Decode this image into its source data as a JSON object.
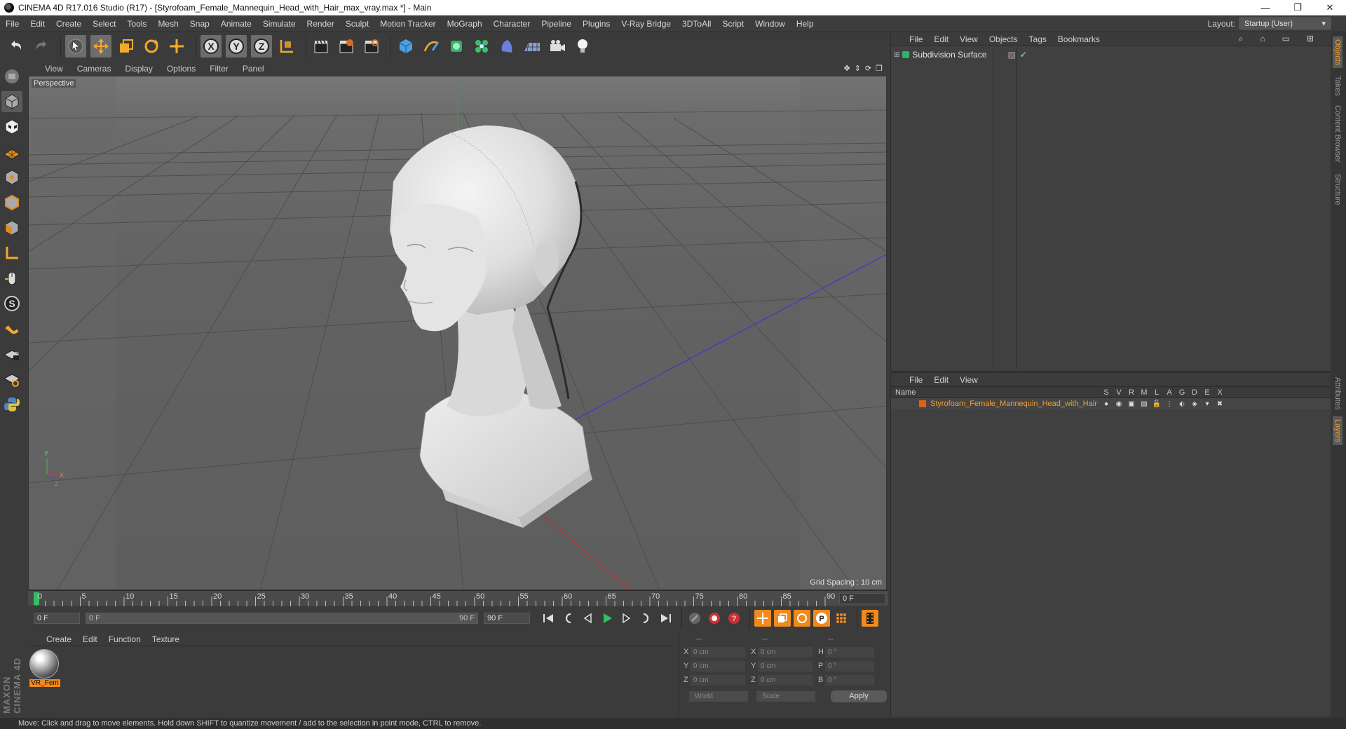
{
  "window": {
    "title": "CINEMA 4D R17.016 Studio (R17) - [Styrofoam_Female_Mannequin_Head_with_Hair_max_vray.max *] - Main",
    "controls": [
      "—",
      "❐",
      "✕"
    ]
  },
  "menubar": {
    "items": [
      "File",
      "Edit",
      "Create",
      "Select",
      "Tools",
      "Mesh",
      "Snap",
      "Animate",
      "Simulate",
      "Render",
      "Sculpt",
      "Motion Tracker",
      "MoGraph",
      "Character",
      "Pipeline",
      "Plugins",
      "V-Ray Bridge",
      "3DToAll",
      "Script",
      "Window",
      "Help"
    ],
    "layout_label": "Layout:",
    "layout_value": "Startup (User)"
  },
  "viewport": {
    "menus": [
      "View",
      "Cameras",
      "Display",
      "Options",
      "Filter",
      "Panel"
    ],
    "camera_label": "Perspective",
    "grid_spacing": "Grid Spacing : 10 cm",
    "axis_labels": [
      "Y",
      "X",
      "Z"
    ]
  },
  "timeline": {
    "ticks": [
      "0",
      "5",
      "10",
      "15",
      "20",
      "25",
      "30",
      "35",
      "40",
      "45",
      "50",
      "55",
      "60",
      "65",
      "70",
      "75",
      "80",
      "85",
      "90"
    ],
    "current_frame": "0 F",
    "start_field": "0 F",
    "range_start": "0 F",
    "range_end": "90 F",
    "end_field": "90 F"
  },
  "material_manager": {
    "menus": [
      "Create",
      "Edit",
      "Function",
      "Texture"
    ],
    "material_name": "VR_Fem"
  },
  "coordinates": {
    "top_labels": [
      "--",
      "--",
      "--"
    ],
    "rows": [
      {
        "axis": "X",
        "pos": "0 cm",
        "axis2": "X",
        "size": "0 cm",
        "axis3": "H",
        "rot": "0 °"
      },
      {
        "axis": "Y",
        "pos": "0 cm",
        "axis2": "Y",
        "size": "0 cm",
        "axis3": "P",
        "rot": "0 °"
      },
      {
        "axis": "Z",
        "pos": "0 cm",
        "axis2": "Z",
        "size": "0 cm",
        "axis3": "B",
        "rot": "0 °"
      }
    ],
    "mode_world": "World",
    "mode_scale": "Scale",
    "apply_label": "Apply"
  },
  "object_manager": {
    "menus": [
      "File",
      "Edit",
      "View",
      "Objects",
      "Tags",
      "Bookmarks"
    ],
    "objects": [
      {
        "name": "Subdivision Surface"
      }
    ]
  },
  "layer_manager": {
    "menus": [
      "File",
      "Edit",
      "View"
    ],
    "column_name": "Name",
    "flags": [
      "S",
      "V",
      "R",
      "M",
      "L",
      "A",
      "G",
      "D",
      "E",
      "X"
    ],
    "layers": [
      {
        "name": "Styrofoam_Female_Mannequin_Head_with_Hair",
        "color": "#e06010"
      }
    ]
  },
  "side_tabs": [
    "Objects",
    "Takes",
    "Content Browser",
    "Structure",
    "Attributes",
    "Layers"
  ],
  "status": "Move: Click and drag to move elements. Hold down SHIFT to quantize movement / add to the selection in point mode, CTRL to remove.",
  "colors": {
    "accent": "#f08a1c",
    "panel": "#3b3b3b",
    "viewport": "#626262"
  }
}
